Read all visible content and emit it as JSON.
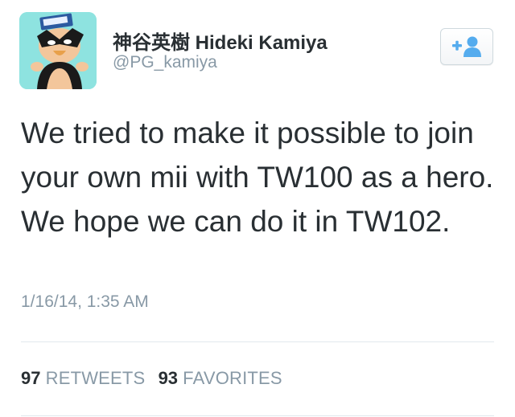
{
  "user": {
    "display_name": "神谷英樹 Hideki Kamiya",
    "handle": "@PG_kamiya",
    "avatar": "cartoon-bird-mask-avatar"
  },
  "follow_button": {
    "icon": "add-user-icon",
    "accent": "#55acee"
  },
  "tweet": {
    "text": "We tried to make it possible to join your own mii with TW100 as a hero. We hope we can do it in TW102.",
    "timestamp": "1/16/14, 1:35 AM"
  },
  "stats": {
    "retweets_count": "97",
    "retweets_label": "RETWEETS",
    "favorites_count": "93",
    "favorites_label": "FAVORITES"
  },
  "colors": {
    "text": "#292f33",
    "muted": "#8899a6",
    "divider": "#e1e8ed",
    "avatar_bg": "#8ee3e0"
  }
}
